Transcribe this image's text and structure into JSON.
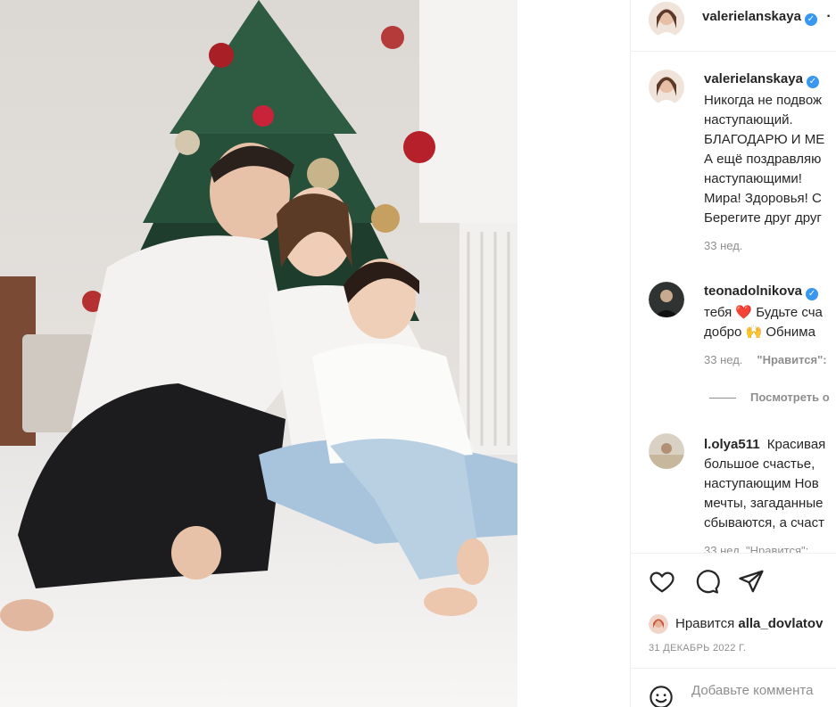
{
  "post": {
    "author": "valerielanskaya",
    "header_more": "·"
  },
  "comments": [
    {
      "username": "valerielanskaya",
      "lines": [
        "Никогда не подвож",
        "наступающий.",
        "БЛАГОДАРЮ И МЕ",
        "А ещё поздравляю",
        "наступающими!",
        "Мира! Здоровья! С",
        "Берегите друг друг"
      ],
      "time": "33 нед."
    },
    {
      "username": "teonadolnikova",
      "lines": [
        "тебя ❤️ Будьте сча",
        "добро 🙌 Обнима"
      ],
      "time": "33 нед.",
      "like_label": "\"Нравится\":",
      "view_replies": "Посмотреть о"
    },
    {
      "username": "l.olya511",
      "first_line_rest": "Красивая",
      "lines": [
        "большое счастье, ",
        "наступающим Нов",
        "мечты, загаданные",
        "сбываются, а счаст"
      ],
      "partial": "33 нед.  \"Нравится\":"
    }
  ],
  "actions": {
    "like_icon": "heart-icon",
    "comment_icon": "comment-icon",
    "share_icon": "paper-plane-icon"
  },
  "likes": {
    "prefix": "Нравится",
    "user": "alla_dovlatov"
  },
  "date": "31 ДЕКАБРЬ 2022 Г.",
  "add_comment": {
    "placeholder": "Добавьте коммента",
    "emoji_icon": "smiley-icon"
  },
  "colors": {
    "verified": "#3897f0",
    "secondary_text": "#8e8e8e",
    "heart": "#ed1c24"
  }
}
